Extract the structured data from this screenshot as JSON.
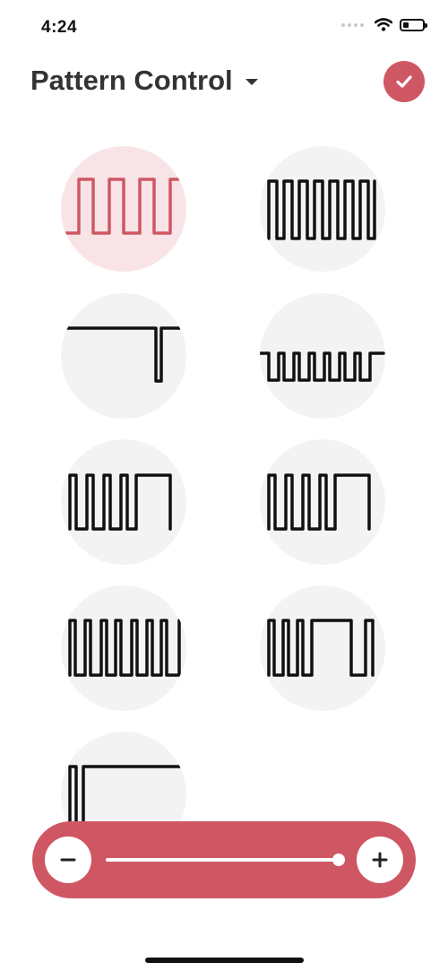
{
  "status_bar": {
    "time": "4:24",
    "battery_level": 0.3
  },
  "header": {
    "title": "Pattern Control",
    "dropdown_icon": "chevron-down-icon",
    "confirm_icon": "checkmark-icon"
  },
  "patterns": {
    "selected_index": 0,
    "items": [
      {
        "name": "pattern-1",
        "shape": "square-wave"
      },
      {
        "name": "pattern-2",
        "shape": "narrow-pulse-train"
      },
      {
        "name": "pattern-3",
        "shape": "single-dip"
      },
      {
        "name": "pattern-4",
        "shape": "short-pulse-train"
      },
      {
        "name": "pattern-5",
        "shape": "pulses-then-wide"
      },
      {
        "name": "pattern-6",
        "shape": "pulses-then-wide-alt"
      },
      {
        "name": "pattern-7",
        "shape": "grouped-pulses"
      },
      {
        "name": "pattern-8",
        "shape": "pulses-wide-pulse"
      },
      {
        "name": "pattern-9",
        "shape": "pulse-then-high"
      }
    ]
  },
  "intensity": {
    "minus_icon": "minus-icon",
    "plus_icon": "plus-icon",
    "level": 1.0
  },
  "colors": {
    "accent": "#cf5764",
    "selected_bg": "#f8e4e6",
    "cell_bg": "#f3f3f3",
    "stroke": "#111111"
  }
}
